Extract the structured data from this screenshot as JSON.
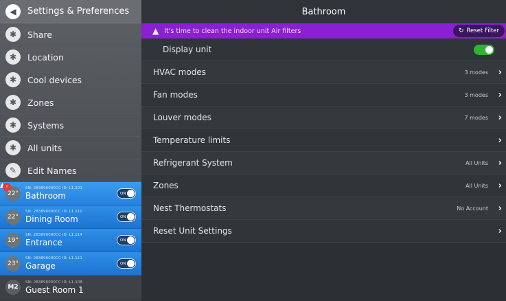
{
  "sidebar": {
    "header": {
      "title": "Settings & Preferences",
      "icon": "back-arrow-icon"
    },
    "items": [
      {
        "label": "Share",
        "icon": "fan-icon"
      },
      {
        "label": "Location",
        "icon": "fan-icon"
      },
      {
        "label": "Cool devices",
        "icon": "fan-icon"
      },
      {
        "label": "Zones",
        "icon": "fan-icon"
      },
      {
        "label": "Systems",
        "icon": "fan-icon"
      },
      {
        "label": "All units",
        "icon": "fan-icon"
      },
      {
        "label": "Edit Names",
        "icon": "pencil-icon"
      }
    ],
    "units": [
      {
        "temp": "22°",
        "sn": "SN: 283896000CC ID: L1.103",
        "name": "Bathroom",
        "toggle": "ON",
        "badge": "!"
      },
      {
        "temp": "22°",
        "sn": "SN: 283896000CC ID: L1.110",
        "name": "Dining Room",
        "toggle": "ON"
      },
      {
        "temp": "19°",
        "sn": "SN: 283896000CC ID: L1.114",
        "name": "Entrance",
        "toggle": "ON"
      },
      {
        "temp": "23°",
        "sn": "SN: 283896000CC ID: L1.111",
        "name": "Garage",
        "toggle": "ON"
      },
      {
        "temp": "M2",
        "sn": "SN: 283896000CC ID: L1.108",
        "name": "Guest Room 1"
      }
    ]
  },
  "main": {
    "title": "Bathroom",
    "alert": {
      "text": "It's time to clean the indoor unit Air filters",
      "button": "Reset Filter"
    },
    "display_unit_label": "Display unit",
    "rows": [
      {
        "label": "HVAC modes",
        "value": "3 modes"
      },
      {
        "label": "Fan modes",
        "value": "3 modes"
      },
      {
        "label": "Louver modes",
        "value": "7 modes"
      },
      {
        "label": "Temperature limits",
        "value": ""
      },
      {
        "label": "Refrigerant System",
        "value": "All Units"
      },
      {
        "label": "Zones",
        "value": "All Units"
      },
      {
        "label": "Nest Thermostats",
        "value": "No Account"
      },
      {
        "label": "Reset Unit Settings",
        "value": ""
      }
    ],
    "chevron": "›"
  },
  "colors": {
    "accent_blue": "#2a8be8",
    "alert_purple": "#8b1fd3",
    "toggle_green": "#2fb52f"
  }
}
